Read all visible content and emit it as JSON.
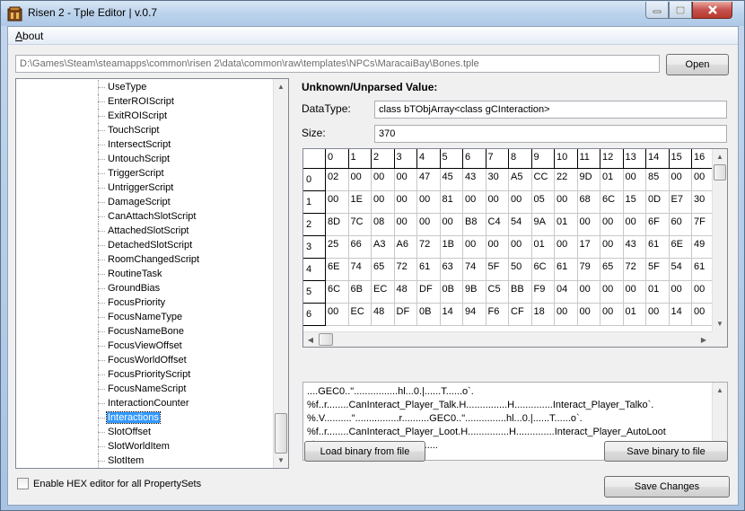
{
  "window": {
    "title": "Risen 2 - Tple Editor | v.0.7"
  },
  "menu": {
    "about_label": "About"
  },
  "file": {
    "path": "D:\\Games\\Steam\\steamapps\\common\\risen 2\\data\\common\\raw\\templates\\NPCs\\MaracaiBay\\Bones.tple",
    "open_label": "Open"
  },
  "tree": {
    "items": [
      "UseType",
      "EnterROIScript",
      "ExitROIScript",
      "TouchScript",
      "IntersectScript",
      "UntouchScript",
      "TriggerScript",
      "UntriggerScript",
      "DamageScript",
      "CanAttachSlotScript",
      "AttachedSlotScript",
      "DetachedSlotScript",
      "RoomChangedScript",
      "RoutineTask",
      "GroundBias",
      "FocusPriority",
      "FocusNameType",
      "FocusNameBone",
      "FocusViewOffset",
      "FocusWorldOffset",
      "FocusPriorityScript",
      "FocusNameScript",
      "InteractionCounter",
      "Interactions",
      "SlotOffset",
      "SlotWorldItem",
      "SlotItem"
    ],
    "selected": "Interactions"
  },
  "options": {
    "hex_editor_label": "Enable HEX editor for all PropertySets"
  },
  "value": {
    "section_title": "Unknown/Unparsed Value:",
    "datatype_label": "DataType:",
    "datatype_value": "class bTObjArray<class gCInteraction>",
    "size_label": "Size:",
    "size_value": "370"
  },
  "hex": {
    "columns": [
      "0",
      "1",
      "2",
      "3",
      "4",
      "5",
      "6",
      "7",
      "8",
      "9",
      "10",
      "11",
      "12",
      "13",
      "14",
      "15",
      "16"
    ],
    "rows": [
      {
        "index": "0",
        "cells": [
          "02",
          "00",
          "00",
          "00",
          "47",
          "45",
          "43",
          "30",
          "A5",
          "CC",
          "22",
          "9D",
          "01",
          "00",
          "85",
          "00",
          "00"
        ]
      },
      {
        "index": "1",
        "cells": [
          "00",
          "1E",
          "00",
          "00",
          "00",
          "81",
          "00",
          "00",
          "00",
          "05",
          "00",
          "68",
          "6C",
          "15",
          "0D",
          "E7",
          "30"
        ]
      },
      {
        "index": "2",
        "cells": [
          "8D",
          "7C",
          "08",
          "00",
          "00",
          "00",
          "B8",
          "C4",
          "54",
          "9A",
          "01",
          "00",
          "00",
          "00",
          "6F",
          "60",
          "7F"
        ]
      },
      {
        "index": "3",
        "cells": [
          "25",
          "66",
          "A3",
          "A6",
          "72",
          "1B",
          "00",
          "00",
          "00",
          "01",
          "00",
          "17",
          "00",
          "43",
          "61",
          "6E",
          "49"
        ]
      },
      {
        "index": "4",
        "cells": [
          "6E",
          "74",
          "65",
          "72",
          "61",
          "63",
          "74",
          "5F",
          "50",
          "6C",
          "61",
          "79",
          "65",
          "72",
          "5F",
          "54",
          "61"
        ]
      },
      {
        "index": "5",
        "cells": [
          "6C",
          "6B",
          "EC",
          "48",
          "DF",
          "0B",
          "9B",
          "C5",
          "BB",
          "F9",
          "04",
          "00",
          "00",
          "00",
          "01",
          "00",
          "00"
        ]
      },
      {
        "index": "6",
        "cells": [
          "00",
          "EC",
          "48",
          "DF",
          "0B",
          "14",
          "94",
          "F6",
          "CF",
          "18",
          "00",
          "00",
          "00",
          "01",
          "00",
          "14",
          "00"
        ]
      }
    ]
  },
  "ascii": {
    "text": "....GEC0..\"................hl...0.|......T......o`.\n%f..r........CanInteract_Player_Talk.H...............H..............Interact_Player_Talko`.\n%.V..........\"................r..........GEC0..\"...............hl...0.|......T......o`.\n%f..r........CanInteract_Player_Loot.H...............H..............Interact_Player_AutoLoot\no`.%.V...........\"................r........"
  },
  "actions": {
    "load_binary_label": "Load binary from file",
    "save_binary_label": "Save binary to file",
    "save_changes_label": "Save Changes"
  }
}
